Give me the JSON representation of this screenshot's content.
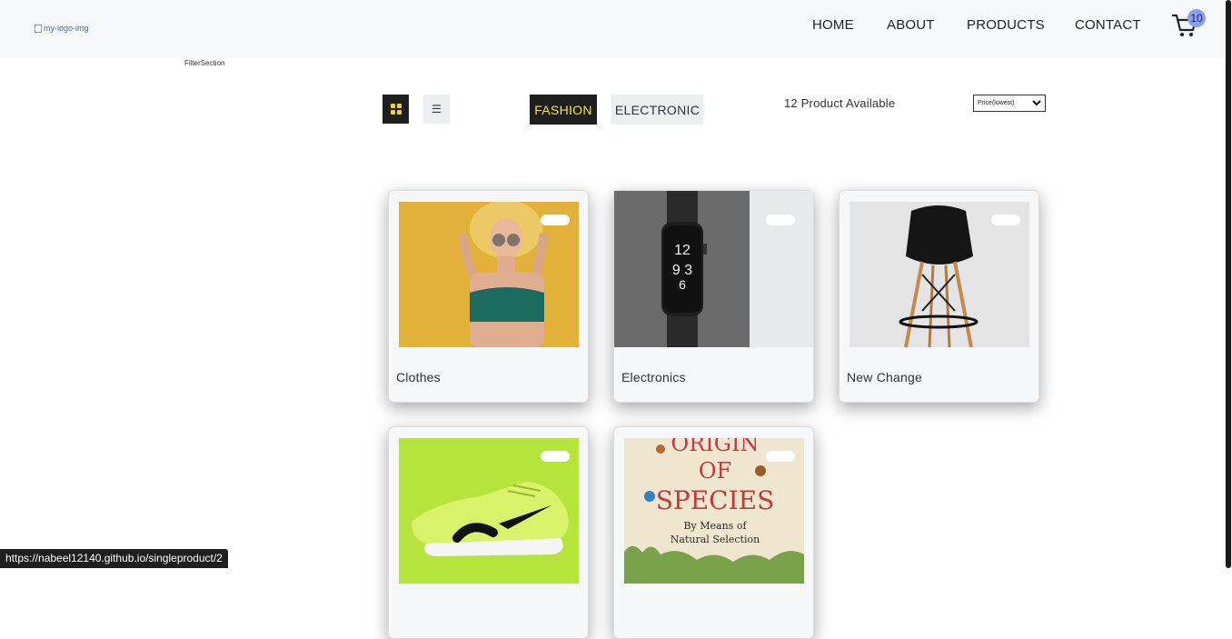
{
  "header": {
    "logo_alt": "my-logo-img",
    "nav": [
      "HOME",
      "ABOUT",
      "PRODUCTS",
      "CONTACT"
    ],
    "cart_count": "10"
  },
  "filter_section_label": "FilterSection",
  "toolbar": {
    "categories": [
      "FASHION",
      "ELECTRONIC"
    ],
    "product_count": "12 Product Available",
    "sort_selected": "Price(lowest)"
  },
  "products": [
    {
      "name": "Clothes"
    },
    {
      "name": "Electronics"
    },
    {
      "name": "New Change"
    },
    {
      "name": ""
    },
    {
      "name": ""
    }
  ],
  "book_cover": {
    "title_line1": "ORIGIN",
    "title_line2": "OF",
    "title_line3": "SPECIES",
    "subtitle_line1": "By Means of",
    "subtitle_line2": "Natural Selection"
  },
  "status_url": "https://nabeel12140.github.io/singleproduct/2",
  "colors": {
    "accent_yellow": "#f2e63a",
    "dark": "#1f1f1f",
    "badge": "#8c9ff0"
  }
}
